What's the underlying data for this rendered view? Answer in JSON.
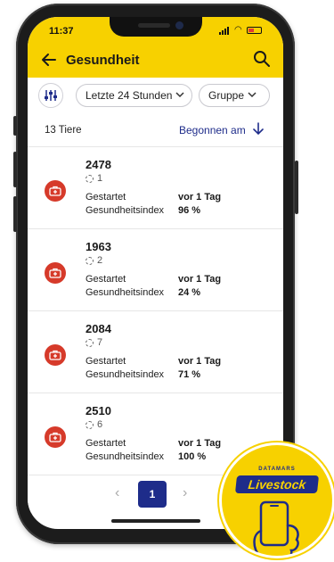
{
  "status": {
    "time": "11:37"
  },
  "appbar": {
    "title": "Gesundheit"
  },
  "filters": {
    "chip1": "Letzte 24 Stunden",
    "chip2": "Gruppe"
  },
  "header": {
    "count": "13 Tiere",
    "sort_label": "Begonnen am"
  },
  "items": [
    {
      "number": "2478",
      "sub": "1",
      "label1": "Gestartet",
      "value1": "vor 1 Tag",
      "label2": "Gesundheitsindex",
      "value2": "96 %"
    },
    {
      "number": "1963",
      "sub": "2",
      "label1": "Gestartet",
      "value1": "vor 1 Tag",
      "label2": "Gesundheitsindex",
      "value2": "24 %"
    },
    {
      "number": "2084",
      "sub": "7",
      "label1": "Gestartet",
      "value1": "vor 1 Tag",
      "label2": "Gesundheitsindex",
      "value2": "71 %"
    },
    {
      "number": "2510",
      "sub": "6",
      "label1": "Gestartet",
      "value1": "vor 1 Tag",
      "label2": "Gesundheitsindex",
      "value2": "100 %"
    }
  ],
  "pager": {
    "current_page": "1"
  },
  "badge": {
    "brand": "DATAMARS",
    "logo": "Livestock"
  },
  "colors": {
    "accent": "#f7d100",
    "primary": "#1e2c8a",
    "alert": "#d63a2a"
  },
  "icons": {
    "back": "arrow-left-icon",
    "search": "search-icon",
    "filter": "filter-sliders-icon",
    "chevron": "chevron-down-icon",
    "sort": "arrow-down-icon",
    "item": "medical-case-icon",
    "prev": "chevron-left-icon",
    "next": "chevron-right-icon"
  }
}
